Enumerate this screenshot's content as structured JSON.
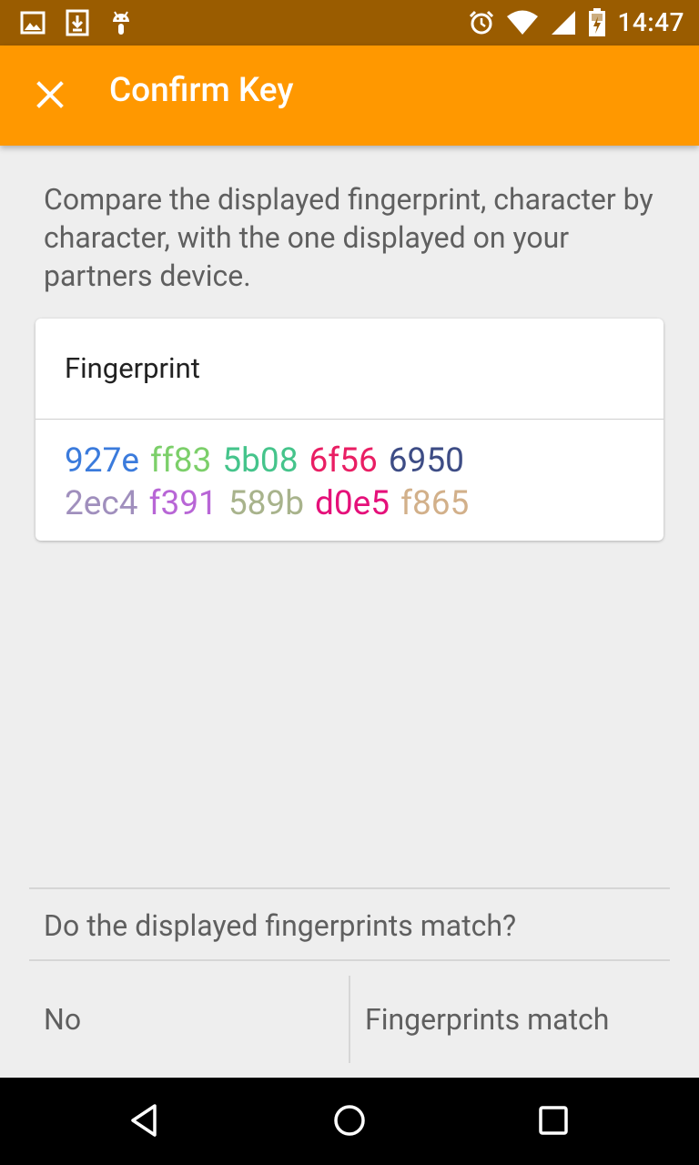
{
  "status_bar": {
    "time": "14:47",
    "left_icons": [
      "image-icon",
      "download-icon",
      "android-icon"
    ],
    "right_icons": [
      "alarm-icon",
      "wifi-icon",
      "signal-icon",
      "battery-charging-icon"
    ]
  },
  "toolbar": {
    "title": "Confirm Key",
    "close_icon": "close-icon",
    "background": "#ff9800"
  },
  "instructions": "Compare the displayed fingerprint, character by character, with the one displayed on your partners device.",
  "card": {
    "title": "Fingerprint",
    "fingerprint_rows": [
      [
        {
          "text": "927e",
          "color": "#3b7bdc"
        },
        {
          "text": "ff83",
          "color": "#7ccf6a"
        },
        {
          "text": "5b08",
          "color": "#45c48b"
        },
        {
          "text": "6f56",
          "color": "#e91e63"
        },
        {
          "text": "6950",
          "color": "#3d4c85"
        }
      ],
      [
        {
          "text": "2ec4",
          "color": "#a08fbd"
        },
        {
          "text": "f391",
          "color": "#b866d6"
        },
        {
          "text": "589b",
          "color": "#a8b38c"
        },
        {
          "text": "d0e5",
          "color": "#e5107a"
        },
        {
          "text": "f865",
          "color": "#d2b08a"
        }
      ]
    ]
  },
  "question": "Do the displayed fingerprints match?",
  "buttons": {
    "no": "No",
    "match": "Fingerprints match"
  },
  "nav_bar": {
    "icons": [
      "back-icon",
      "home-icon",
      "recents-icon"
    ]
  }
}
